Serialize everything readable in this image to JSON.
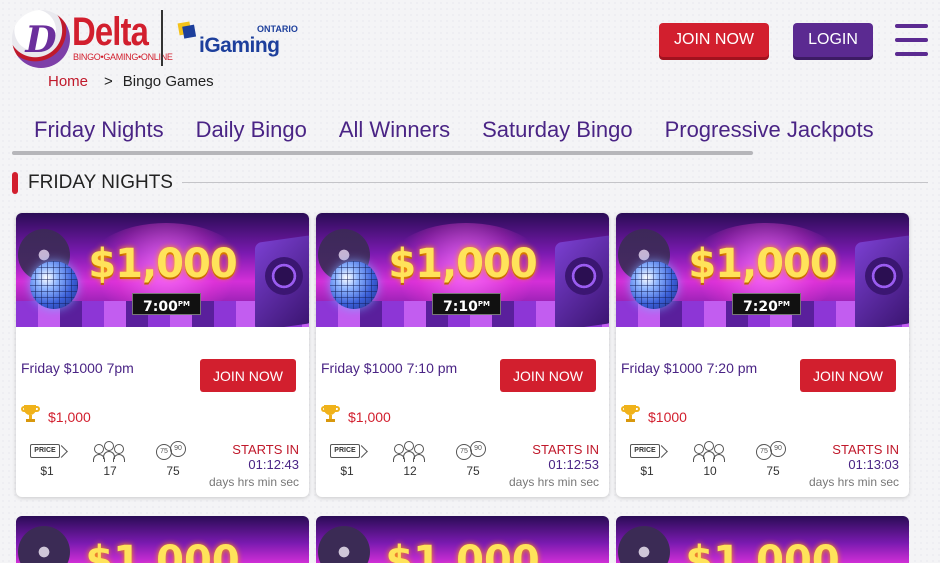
{
  "header": {
    "logo_text": "Delta",
    "logo_tagline": "BINGO•GAMING•ONLINE",
    "partner_top": "ONTARIO",
    "partner_name": "iGaming",
    "join_label": "JOIN NOW",
    "login_label": "LOGIN"
  },
  "breadcrumb": {
    "home": "Home",
    "separator": ">",
    "current": "Bingo Games"
  },
  "tabs": [
    {
      "label": "Friday Nights"
    },
    {
      "label": "Daily Bingo"
    },
    {
      "label": "All Winners"
    },
    {
      "label": "Saturday Bingo"
    },
    {
      "label": "Progressive Jackpots"
    }
  ],
  "section": {
    "title": "FRIDAY NIGHTS"
  },
  "cards": [
    {
      "banner_amount": "$1,000",
      "banner_time": "7:00",
      "banner_ampm": "PM",
      "name": "Friday $1000 7pm",
      "join_label": "JOIN NOW",
      "prize": "$1,000",
      "price_tag": "PRICE",
      "price": "$1",
      "players": "17",
      "balls": "75",
      "starts_label": "STARTS IN",
      "countdown": "01:12:43",
      "units": "days hrs min sec"
    },
    {
      "banner_amount": "$1,000",
      "banner_time": "7:10",
      "banner_ampm": "PM",
      "name": "Friday $1000 7:10 pm",
      "join_label": "JOIN NOW",
      "prize": "$1,000",
      "price_tag": "PRICE",
      "price": "$1",
      "players": "12",
      "balls": "75",
      "starts_label": "STARTS IN",
      "countdown": "01:12:53",
      "units": "days hrs min sec"
    },
    {
      "banner_amount": "$1,000",
      "banner_time": "7:20",
      "banner_ampm": "PM",
      "name": "Friday $1000 7:20 pm",
      "join_label": "JOIN NOW",
      "prize": "$1000",
      "price_tag": "PRICE",
      "price": "$1",
      "players": "10",
      "balls": "75",
      "starts_label": "STARTS IN",
      "countdown": "01:13:03",
      "units": "days hrs min sec"
    }
  ],
  "partial_cards": [
    {
      "banner_amount": "$1,000"
    },
    {
      "banner_amount": "$1,000"
    },
    {
      "banner_amount": "$1,000"
    }
  ],
  "colors": {
    "brand_red": "#d21f2e",
    "brand_purple": "#5b2a91",
    "tab_text": "#4a2485"
  }
}
